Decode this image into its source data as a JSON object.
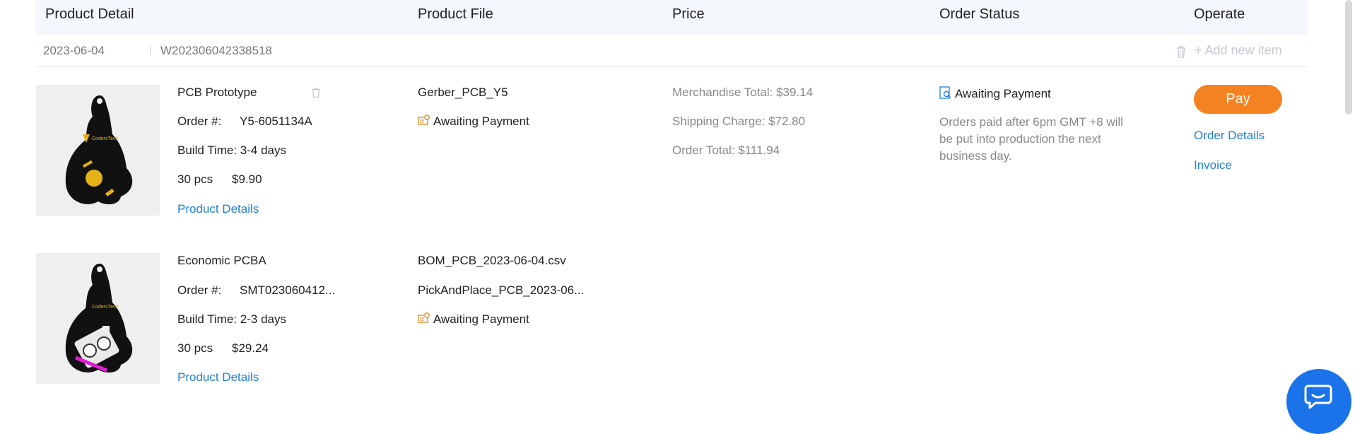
{
  "header": {
    "product_detail": "Product Detail",
    "product_file": "Product File",
    "price": "Price",
    "order_status": "Order Status",
    "operate": "Operate"
  },
  "order": {
    "date": "2023-06-04",
    "number": "W202306042338518",
    "add_new_item": "+ Add new item"
  },
  "items": [
    {
      "name": "PCB Prototype",
      "order_label": "Order #:",
      "order_no": "Y5-6051134A",
      "build_time": "Build Time: 3-4 days",
      "qty": "30 pcs",
      "price": "$9.90",
      "details_link": "Product Details",
      "files": [
        "Gerber_PCB_Y5"
      ],
      "file_status": "Awaiting Payment"
    },
    {
      "name": "Economic PCBA",
      "order_label": "Order #:",
      "order_no": "SMT023060412...",
      "build_time": "Build Time: 2-3 days",
      "qty": "30 pcs",
      "price": "$29.24",
      "details_link": "Product Details",
      "files": [
        "BOM_PCB_2023-06-04.csv",
        "PickAndPlace_PCB_2023-06..."
      ],
      "file_status": "Awaiting Payment"
    }
  ],
  "price": {
    "merchandise_total": "Merchandise Total: $39.14",
    "shipping_charge": "Shipping Charge: $72.80",
    "order_total": "Order Total: $111.94"
  },
  "status": {
    "label": "Awaiting Payment",
    "note": "Orders paid after 6pm GMT +8 will be put into production the next business day."
  },
  "operate": {
    "pay": "Pay",
    "order_details": "Order Details",
    "invoice": "Invoice"
  },
  "colors": {
    "accent_orange": "#f58220",
    "link_blue": "#1f7fd8",
    "header_bg": "#f4f7fb",
    "chat_blue": "#1a73e8"
  },
  "icons": [
    "trash-icon",
    "plus-icon",
    "file-status-icon",
    "order-status-icon",
    "chat-icon"
  ]
}
